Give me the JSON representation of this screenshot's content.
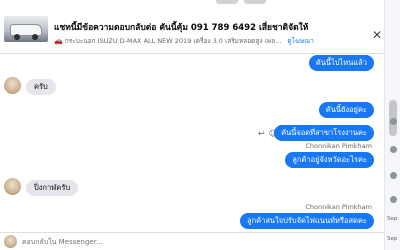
{
  "header": {
    "title": "แชทนี้มีข้อความตอบกลับต่อ คันนี้คุ้ม 091 789 6492 เสี่ยชาติจัดให้",
    "listing_icon": "car-emoji",
    "listing_text": "กระบะนอก ISUZU D-MAX ALL NEW 2019 เครื่อง 3.0 เสริมหลอดสูง เพล...",
    "view_label": "ดูโฆษณา"
  },
  "messages": [
    {
      "side": "out",
      "text": "คันนี้ไปไหนแล้ว"
    },
    {
      "side": "in",
      "text": "ครับ"
    },
    {
      "side": "out",
      "text": "คันนี้ยังอยู่คะ"
    },
    {
      "side": "out",
      "text": "คันนี้จอดที่สาขาโรงงานคะ"
    },
    {
      "side": "out",
      "text": "ลูกค้าอยู่จังหวัดอะไรคะ"
    },
    {
      "side": "in",
      "text": "ปิ่งกาฬครับ"
    },
    {
      "side": "out",
      "text": "ลูกค้าสนใจปรับจัดไฟแนนท์หรือสดคะ"
    }
  ],
  "senders": [
    "Chonnikan Pimkham",
    "Chonnikan Pimkham"
  ],
  "composer": {
    "placeholder": "ตอบกลับใน Messenger..."
  },
  "sidebar": {
    "label_1": "Sep",
    "label_2": "Sep"
  },
  "colors": {
    "accent": "#1877f2",
    "incoming": "#e4e6eb"
  }
}
